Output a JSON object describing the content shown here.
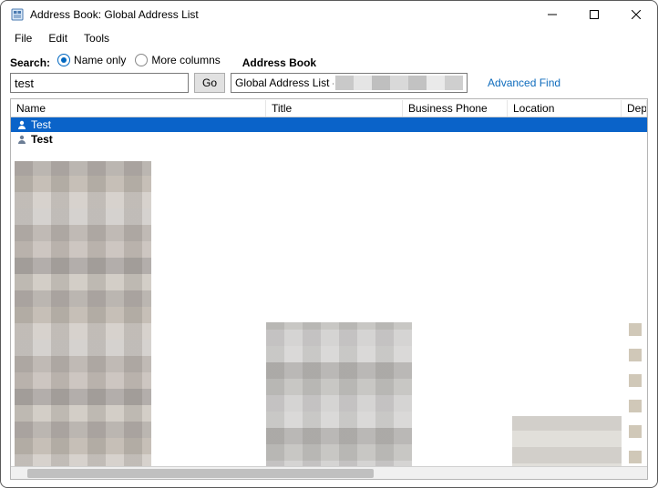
{
  "window": {
    "title": "Address Book: Global Address List"
  },
  "menubar": {
    "items": [
      "File",
      "Edit",
      "Tools"
    ]
  },
  "search": {
    "label": "Search:",
    "radio_name_only": "Name only",
    "radio_more_columns": "More columns",
    "value": "test",
    "go_label": "Go"
  },
  "address_book": {
    "label": "Address Book",
    "selected_prefix": "Global Address List - ",
    "advanced_find": "Advanced Find"
  },
  "columns": {
    "name": "Name",
    "title": "Title",
    "phone": "Business Phone",
    "location": "Location",
    "dept": "Dep"
  },
  "rows": [
    {
      "name": "Test",
      "selected": true,
      "bold": false
    },
    {
      "name": "Test",
      "selected": false,
      "bold": true
    }
  ]
}
